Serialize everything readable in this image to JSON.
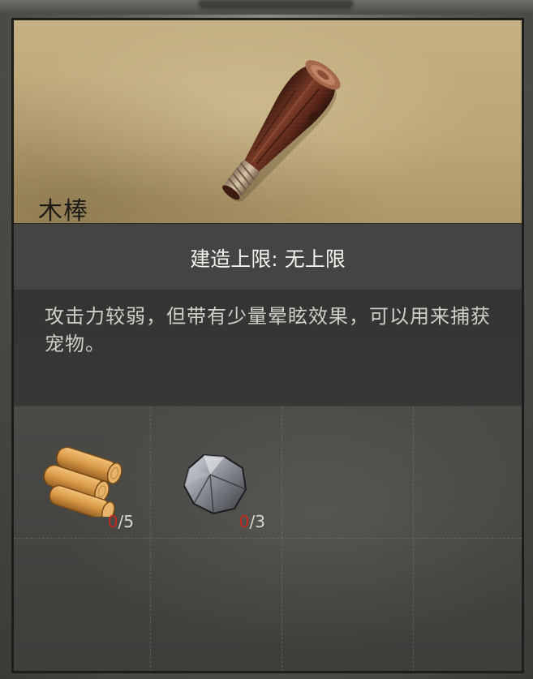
{
  "item": {
    "name": "木棒",
    "icon": "wooden-club-icon"
  },
  "build_limit": {
    "label": "建造上限",
    "separator": ":",
    "value": "无上限"
  },
  "description": "攻击力较弱，但带有少量晕眩效果，可以用来捕获宠物。",
  "materials": [
    {
      "icon": "wood-logs-icon",
      "have": "0",
      "need": "5"
    },
    {
      "icon": "stone-icon",
      "have": "0",
      "need": "3"
    }
  ],
  "colors": {
    "insufficient": "#c8281e",
    "parchment": "#bba676",
    "panel_dark": "#343432"
  }
}
